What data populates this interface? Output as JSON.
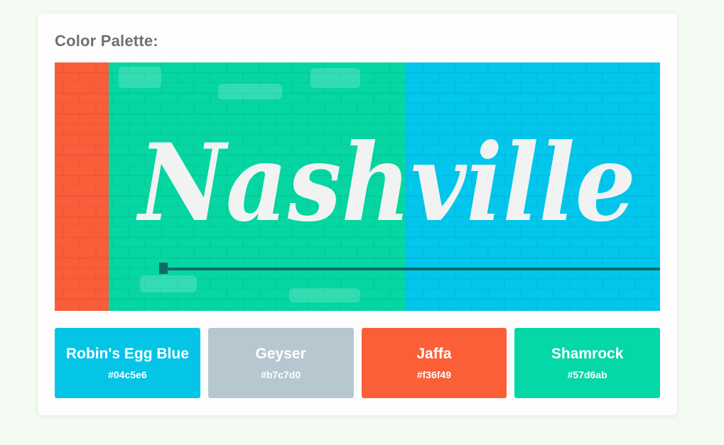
{
  "palette": {
    "title": "Color Palette:",
    "image": {
      "sign_text": "Nashville",
      "colors": {
        "left_wall": "#fa5d3a",
        "middle_wall": "#05d6a2",
        "right_wall": "#02c6ec",
        "lettering": "#f1f3f2",
        "pipe": "#0f6a64"
      }
    },
    "swatches": [
      {
        "name": "Robin's Egg Blue",
        "hex": "#04c5e6",
        "color": "#04c5e6"
      },
      {
        "name": "Geyser",
        "hex": "#b7c7d0",
        "color": "#b7c7d0"
      },
      {
        "name": "Jaffa",
        "hex": "#f36f49",
        "color": "#fb5f37"
      },
      {
        "name": "Shamrock",
        "hex": "#57d6ab",
        "color": "#05d8a6"
      }
    ]
  }
}
